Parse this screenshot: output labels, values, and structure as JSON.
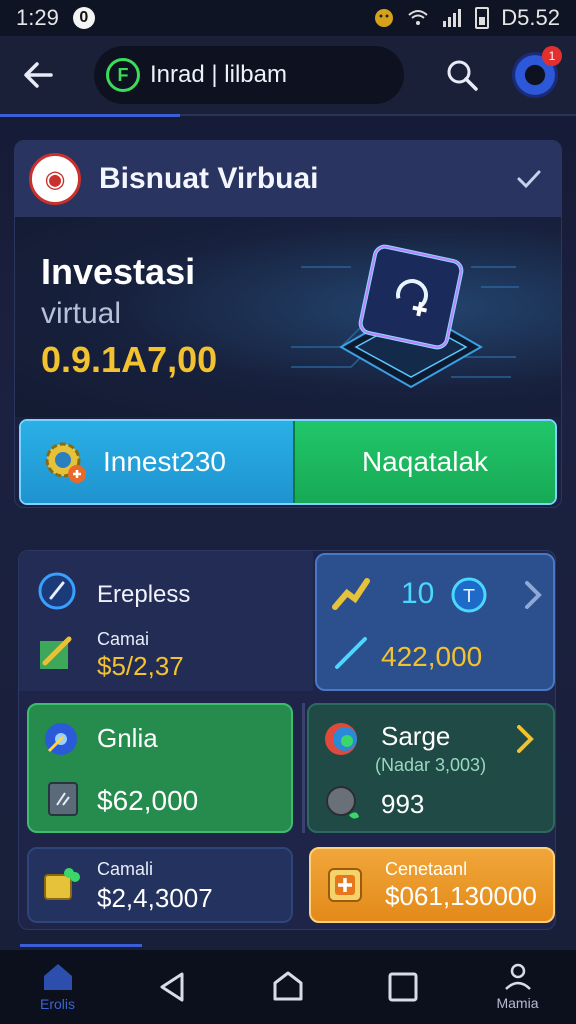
{
  "status_bar": {
    "time": "1:29",
    "notification_badge": "0",
    "clock_right": "D5.52"
  },
  "app_bar": {
    "search_text": "Inrad | lilbam",
    "notification_count": "1"
  },
  "card": {
    "title": "Bisnuat Virbuai",
    "hero_title": "Investasi",
    "hero_subtitle": "virtual",
    "hero_amount": "0.9.1A7,00",
    "invest_button_label": "Innest230",
    "refund_button_label": "Naqatalak"
  },
  "tiles": {
    "expenses": {
      "title": "Erepless",
      "label": "Camai",
      "value": "$5/2,37"
    },
    "blue": {
      "top_value": "10",
      "value": "422,000"
    },
    "green": {
      "title": "Gnlia",
      "value": "$62,000"
    },
    "dark": {
      "title": "Sarge",
      "subtitle": "(Nadar 3,003)",
      "value": "993"
    },
    "small": {
      "label": "Camali",
      "value": "$2,4,3007"
    },
    "orange": {
      "label": "Cenetaanl",
      "value": "$061,130000"
    }
  },
  "nav": {
    "home_label": "Erolis",
    "menu_label": "Mamia"
  },
  "colors": {
    "accent_blue": "#3b5dd6",
    "gold": "#f2c230",
    "green": "#21c76a",
    "cyan": "#2ab0e6",
    "orange": "#f1a63a"
  }
}
